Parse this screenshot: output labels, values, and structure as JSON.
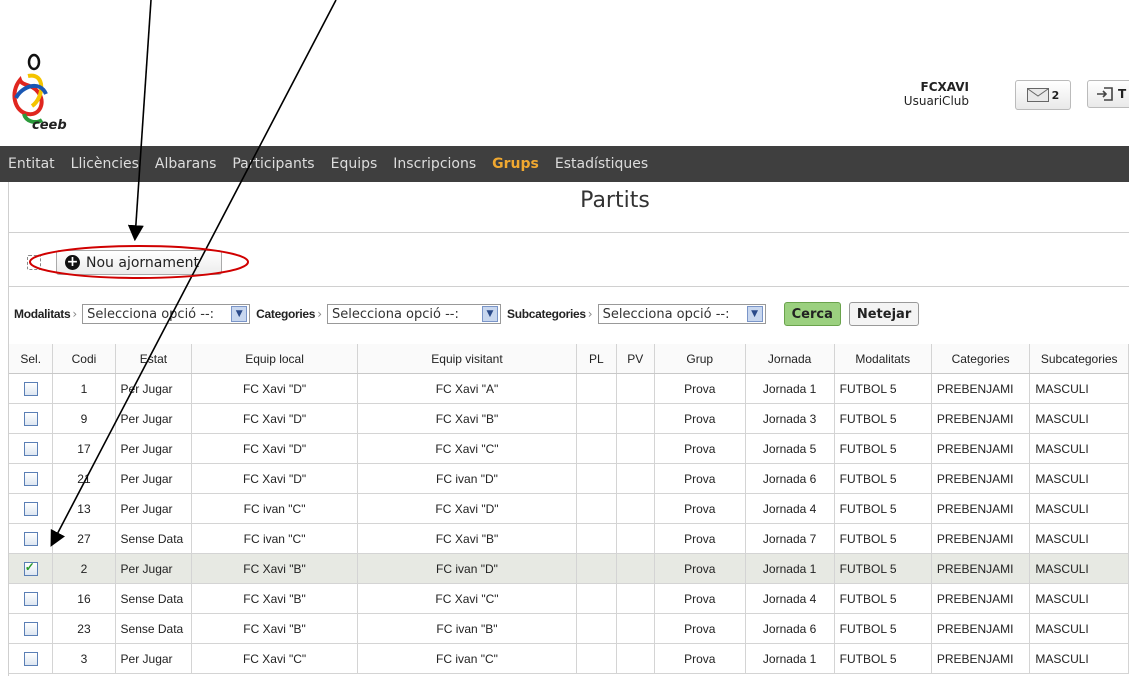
{
  "header": {
    "logo_text": "ceeb",
    "user_name": "FCXAVI",
    "user_role": "UsuariClub",
    "messages_count": "2",
    "exit_label": "T"
  },
  "nav": {
    "items": [
      "Entitat",
      "Llicències",
      "Albarans",
      "Participants",
      "Equips",
      "Inscripcions",
      "Grups",
      "Estadístiques"
    ],
    "active": "Grups"
  },
  "page": {
    "title": "Partits",
    "new_button": "Nou ajornament"
  },
  "filters": {
    "modalitats_label": "Modalitats",
    "categories_label": "Categories",
    "subcategories_label": "Subcategories",
    "select_placeholder": "Selecciona opció --:",
    "search_button": "Cerca",
    "clear_button": "Netejar"
  },
  "table": {
    "columns": [
      "Sel.",
      "Codi",
      "Estat",
      "Equip local",
      "Equip visitant",
      "PL",
      "PV",
      "Grup",
      "Jornada",
      "Modalitats",
      "Categories",
      "Subcategories"
    ],
    "rows": [
      {
        "checked": false,
        "codi": "1",
        "estat": "Per Jugar",
        "local": "FC Xavi \"D\"",
        "visitant": "FC Xavi \"A\"",
        "pl": "",
        "pv": "",
        "grup": "Prova",
        "jornada": "Jornada 1",
        "modalitat": "FUTBOL 5",
        "categoria": "PREBENJAMI",
        "subcategoria": "MASCULI"
      },
      {
        "checked": false,
        "codi": "9",
        "estat": "Per Jugar",
        "local": "FC Xavi \"D\"",
        "visitant": "FC Xavi \"B\"",
        "pl": "",
        "pv": "",
        "grup": "Prova",
        "jornada": "Jornada 3",
        "modalitat": "FUTBOL 5",
        "categoria": "PREBENJAMI",
        "subcategoria": "MASCULI"
      },
      {
        "checked": false,
        "codi": "17",
        "estat": "Per Jugar",
        "local": "FC Xavi \"D\"",
        "visitant": "FC Xavi \"C\"",
        "pl": "",
        "pv": "",
        "grup": "Prova",
        "jornada": "Jornada 5",
        "modalitat": "FUTBOL 5",
        "categoria": "PREBENJAMI",
        "subcategoria": "MASCULI"
      },
      {
        "checked": false,
        "codi": "21",
        "estat": "Per Jugar",
        "local": "FC Xavi \"D\"",
        "visitant": "FC ivan \"D\"",
        "pl": "",
        "pv": "",
        "grup": "Prova",
        "jornada": "Jornada 6",
        "modalitat": "FUTBOL 5",
        "categoria": "PREBENJAMI",
        "subcategoria": "MASCULI"
      },
      {
        "checked": false,
        "codi": "13",
        "estat": "Per Jugar",
        "local": "FC ivan \"C\"",
        "visitant": "FC Xavi \"D\"",
        "pl": "",
        "pv": "",
        "grup": "Prova",
        "jornada": "Jornada 4",
        "modalitat": "FUTBOL 5",
        "categoria": "PREBENJAMI",
        "subcategoria": "MASCULI"
      },
      {
        "checked": false,
        "codi": "27",
        "estat": "Sense Data",
        "local": "FC ivan \"C\"",
        "visitant": "FC Xavi \"B\"",
        "pl": "",
        "pv": "",
        "grup": "Prova",
        "jornada": "Jornada 7",
        "modalitat": "FUTBOL 5",
        "categoria": "PREBENJAMI",
        "subcategoria": "MASCULI"
      },
      {
        "checked": true,
        "codi": "2",
        "estat": "Per Jugar",
        "local": "FC Xavi \"B\"",
        "visitant": "FC ivan \"D\"",
        "pl": "",
        "pv": "",
        "grup": "Prova",
        "jornada": "Jornada 1",
        "modalitat": "FUTBOL 5",
        "categoria": "PREBENJAMI",
        "subcategoria": "MASCULI"
      },
      {
        "checked": false,
        "codi": "16",
        "estat": "Sense Data",
        "local": "FC Xavi \"B\"",
        "visitant": "FC Xavi \"C\"",
        "pl": "",
        "pv": "",
        "grup": "Prova",
        "jornada": "Jornada 4",
        "modalitat": "FUTBOL 5",
        "categoria": "PREBENJAMI",
        "subcategoria": "MASCULI"
      },
      {
        "checked": false,
        "codi": "23",
        "estat": "Sense Data",
        "local": "FC Xavi \"B\"",
        "visitant": "FC ivan \"B\"",
        "pl": "",
        "pv": "",
        "grup": "Prova",
        "jornada": "Jornada 6",
        "modalitat": "FUTBOL 5",
        "categoria": "PREBENJAMI",
        "subcategoria": "MASCULI"
      },
      {
        "checked": false,
        "codi": "3",
        "estat": "Per Jugar",
        "local": "FC Xavi \"C\"",
        "visitant": "FC ivan \"C\"",
        "pl": "",
        "pv": "",
        "grup": "Prova",
        "jornada": "Jornada 1",
        "modalitat": "FUTBOL 5",
        "categoria": "PREBENJAMI",
        "subcategoria": "MASCULI"
      }
    ]
  },
  "colors": {
    "nav_bg": "#3f3f3f",
    "nav_active": "#f0a830",
    "search_button": "#9bd07f",
    "annotation": "#d00000"
  }
}
